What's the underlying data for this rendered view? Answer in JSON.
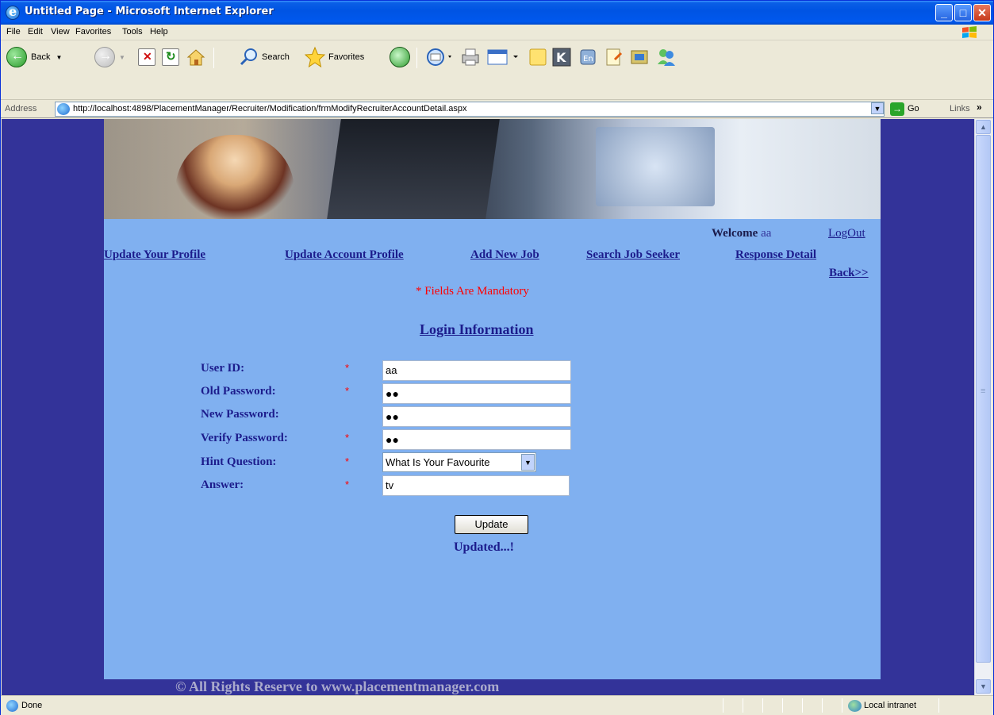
{
  "window": {
    "title": "Untitled Page - Microsoft Internet Explorer",
    "controls": {
      "minimize": "_",
      "maximize": "□",
      "close": "✕"
    }
  },
  "menu": {
    "items": [
      "File",
      "Edit",
      "View",
      "Favorites",
      "Tools",
      "Help"
    ]
  },
  "toolbar": {
    "back_label": "Back",
    "search_label": "Search",
    "favorites_label": "Favorites"
  },
  "address": {
    "label": "Address",
    "url": "http://localhost:4898/PlacementManager/Recruiter/Modification/frmModifyRecruiterAccountDetail.aspx",
    "go_label": "Go",
    "links_label": "Links"
  },
  "page": {
    "welcome_label": "Welcome",
    "welcome_user": "aa",
    "logout": "LogOut",
    "nav": {
      "update_profile": "Update Your Profile",
      "update_account": "Update Account Profile",
      "add_job": "Add New Job",
      "search_seeker": "Search Job Seeker",
      "response_detail": "Response Detail",
      "back": "Back>>"
    },
    "mandatory_note": "* Fields Are Mandatory",
    "section_heading": "Login Information",
    "form": {
      "user_id_label": "User ID:",
      "user_id_value": "aa",
      "old_password_label": "Old Password:",
      "old_password_value": "●●",
      "new_password_label": "New Password:",
      "new_password_value": "●●",
      "verify_password_label": "Verify Password:",
      "verify_password_value": "●●",
      "hint_label": "Hint Question:",
      "hint_value": "What Is Your Favourite",
      "answer_label": "Answer:",
      "answer_value": "tv",
      "required_mark": "*"
    },
    "update_button": "Update",
    "status_message": "Updated...!",
    "footer": "© All Rights Reserve to www.placementmanager.com"
  },
  "statusbar": {
    "text": "Done",
    "zone": "Local intranet"
  },
  "colors": {
    "page_background": "#333399",
    "content_background": "#80b0f0",
    "link": "#1c1c8c",
    "required": "#ff0000"
  }
}
